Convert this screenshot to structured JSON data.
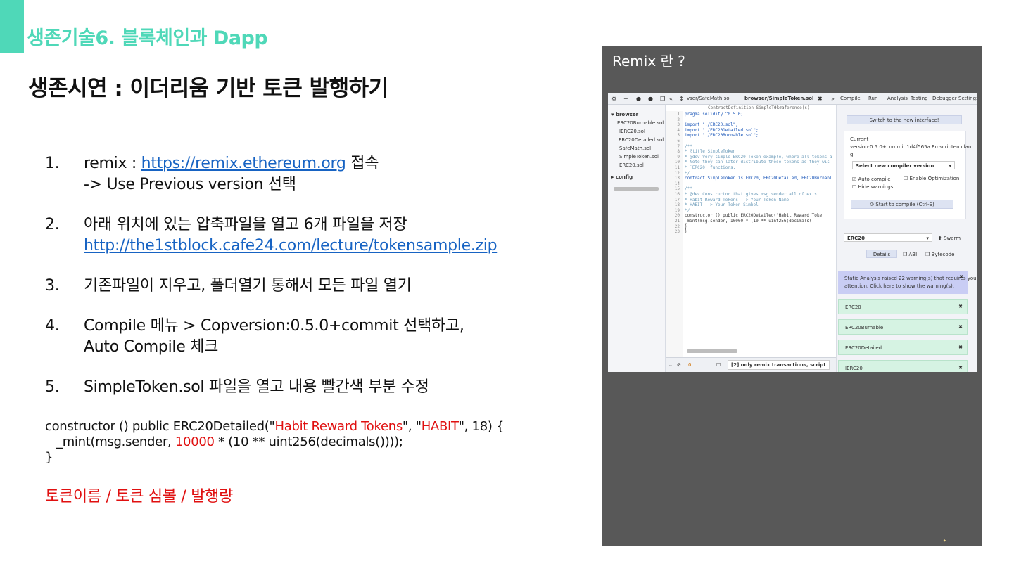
{
  "header": {
    "section_title": "생존기술6. 블록체인과 Dapp",
    "slide_title": "생존시연 : 이더리움 기반 토큰 발행하기"
  },
  "steps": [
    {
      "num": "1.",
      "line1_prefix": "remix : ",
      "line1_link": "https://remix.ethereum.org",
      "line1_suffix": " 접속",
      "line2": "-> Use Previous version 선택"
    },
    {
      "num": "2.",
      "line1": "아래 위치에 있는 압축파일을 열고 6개 파일을 저장",
      "link": "http://the1stblock.cafe24.com/lecture/tokensample.zip"
    },
    {
      "num": "3.",
      "line1": "기존파일이 지우고, 폴더열기 통해서 모든 파일 열기"
    },
    {
      "num": "4.",
      "line1": "Compile 메뉴 > Copversion:0.5.0+commit 선택하고,",
      "line2": "Auto Compile 체크"
    },
    {
      "num": "5.",
      "line1": "SimpleToken.sol 파일을 열고 내용 빨간색 부분 수정"
    }
  ],
  "code": {
    "l1_a": "constructor () public ERC20Detailed(\"",
    "l1_name": "Habit Reward Tokens",
    "l1_b": "\", \"",
    "l1_symbol": "HABIT",
    "l1_c": "\", 18) {",
    "l2_a": "_mint(msg.sender, ",
    "l2_amount": "10000",
    "l2_b": " * (10 ** uint256(decimals())));",
    "l3": "}"
  },
  "note": "토큰이름 / 토큰 심볼 / 발행량",
  "panel": {
    "title": "Remix 란 ?",
    "tabs": [
      "vser/SafeMath.sol",
      "browser/SimpleToken.sol"
    ],
    "right_tabs": [
      "Compile",
      "Run",
      "Analysis",
      "Testing",
      "Debugger",
      "Settings"
    ],
    "context_bar": "ContractDefinition  SimpleToken",
    "references": "0 reference(s)",
    "sidebar": {
      "browser": "browser",
      "files": [
        "ERC20Burnable.sol",
        "IERC20.sol",
        "ERC20Detailed.sol",
        "SafeMath.sol",
        "SimpleToken.sol",
        "ERC20.sol"
      ],
      "config": "config"
    },
    "code_lines": [
      {
        "n": "1",
        "t": "pragma solidity ^0.5.0;",
        "c": "kw"
      },
      {
        "n": "2",
        "t": "",
        "c": ""
      },
      {
        "n": "3",
        "t": "import \"./ERC20.sol\";",
        "c": "kw"
      },
      {
        "n": "4",
        "t": "import \"./ERC20Detailed.sol\";",
        "c": "kw"
      },
      {
        "n": "5",
        "t": "import \"./ERC20Burnable.sol\";",
        "c": "kw"
      },
      {
        "n": "6",
        "t": "",
        "c": ""
      },
      {
        "n": "7",
        "t": "/**",
        "c": "cm"
      },
      {
        "n": "8",
        "t": " * @title SimpleToken",
        "c": "cm"
      },
      {
        "n": "9",
        "t": " * @dev Very simple ERC20 Token example, where all tokens a",
        "c": "cm"
      },
      {
        "n": "10",
        "t": " * Note they can later distribute these tokens as they wis",
        "c": "cm"
      },
      {
        "n": "11",
        "t": " * `ERC20` functions.",
        "c": "cm"
      },
      {
        "n": "12",
        "t": " */",
        "c": "cm"
      },
      {
        "n": "13",
        "t": "contract SimpleToken is ERC20, ERC20Detailed, ERC20Burnabl",
        "c": "kw"
      },
      {
        "n": "14",
        "t": "",
        "c": ""
      },
      {
        "n": "15",
        "t": "    /**",
        "c": "cm"
      },
      {
        "n": "16",
        "t": "     * @dev Constructor that gives msg.sender all of exist",
        "c": "cm"
      },
      {
        "n": "17",
        "t": "     * Habit Reward Tokens --> Your Token Name",
        "c": "cm"
      },
      {
        "n": "18",
        "t": "     * HABIT --> Your Token Simbol",
        "c": "cm"
      },
      {
        "n": "19",
        "t": "     */",
        "c": "cm"
      },
      {
        "n": "20",
        "t": "    constructor () public ERC20Detailed(\"Habit Reward Toke",
        "c": ""
      },
      {
        "n": "21",
        "t": "        _mint(msg.sender, 10000 * (10 ** uint256(decimals(",
        "c": ""
      },
      {
        "n": "22",
        "t": "    }",
        "c": ""
      },
      {
        "n": "23",
        "t": "}",
        "c": ""
      }
    ],
    "bottom_count": "0",
    "bottom_filter": "[2] only remix transactions, script",
    "compile": {
      "switch_btn": "Switch to the new interface!",
      "current_label": "Current",
      "version_line1": "version:0.5.0+commit.1d4f565a.Emscripten.clan",
      "version_line2": "g",
      "select_version": "Select new compiler version",
      "auto_compile": "Auto compile",
      "enable_opt": "Enable Optimization",
      "hide_warnings": "Hide warnings",
      "start_compile": "Start to compile (Ctrl-S)",
      "contract_select": "ERC20",
      "swarm": "Swarm",
      "details": "Details",
      "abi": "ABI",
      "bytecode": "Bytecode",
      "warning_line1": "Static Analysis raised 22 warning(s) that requires your",
      "warning_line2": "attention. Click here to show the warning(s).",
      "results": [
        "ERC20",
        "ERC20Burnable",
        "ERC20Detailed",
        "IERC20"
      ]
    }
  },
  "colors": {
    "accent": "#4fd8b8",
    "link": "#1763c3",
    "highlight_red": "#e01010",
    "panel_bg": "#585858"
  }
}
